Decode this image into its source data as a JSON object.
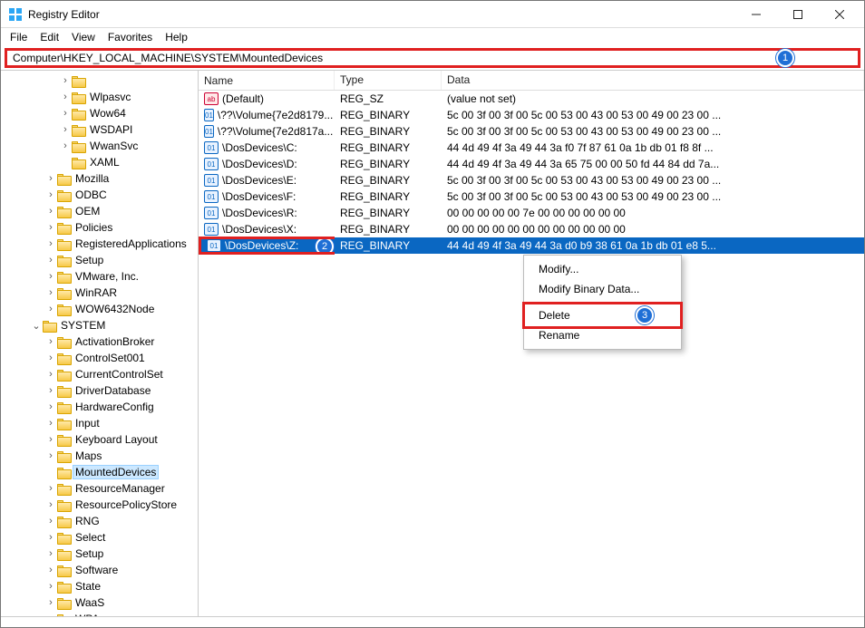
{
  "window": {
    "title": "Registry Editor"
  },
  "menu": {
    "file": "File",
    "edit": "Edit",
    "view": "View",
    "favorites": "Favorites",
    "help": "Help"
  },
  "address": {
    "path": "Computer\\HKEY_LOCAL_MACHINE\\SYSTEM\\MountedDevices"
  },
  "callouts": {
    "one": "1",
    "two": "2",
    "three": "3"
  },
  "tree": {
    "items": [
      {
        "depth": 4,
        "exp": "closed",
        "label": ""
      },
      {
        "depth": 4,
        "exp": "closed",
        "label": "Wlpasvc"
      },
      {
        "depth": 4,
        "exp": "closed",
        "label": "Wow64"
      },
      {
        "depth": 4,
        "exp": "closed",
        "label": "WSDAPI"
      },
      {
        "depth": 4,
        "exp": "closed",
        "label": "WwanSvc"
      },
      {
        "depth": 4,
        "exp": "none",
        "label": "XAML"
      },
      {
        "depth": 3,
        "exp": "closed",
        "label": "Mozilla"
      },
      {
        "depth": 3,
        "exp": "closed",
        "label": "ODBC"
      },
      {
        "depth": 3,
        "exp": "closed",
        "label": "OEM"
      },
      {
        "depth": 3,
        "exp": "closed",
        "label": "Policies"
      },
      {
        "depth": 3,
        "exp": "closed",
        "label": "RegisteredApplications"
      },
      {
        "depth": 3,
        "exp": "closed",
        "label": "Setup"
      },
      {
        "depth": 3,
        "exp": "closed",
        "label": "VMware, Inc."
      },
      {
        "depth": 3,
        "exp": "closed",
        "label": "WinRAR"
      },
      {
        "depth": 3,
        "exp": "closed",
        "label": "WOW6432Node"
      },
      {
        "depth": 2,
        "exp": "open",
        "label": "SYSTEM"
      },
      {
        "depth": 3,
        "exp": "closed",
        "label": "ActivationBroker"
      },
      {
        "depth": 3,
        "exp": "closed",
        "label": "ControlSet001"
      },
      {
        "depth": 3,
        "exp": "closed",
        "label": "CurrentControlSet"
      },
      {
        "depth": 3,
        "exp": "closed",
        "label": "DriverDatabase"
      },
      {
        "depth": 3,
        "exp": "closed",
        "label": "HardwareConfig"
      },
      {
        "depth": 3,
        "exp": "closed",
        "label": "Input"
      },
      {
        "depth": 3,
        "exp": "closed",
        "label": "Keyboard Layout"
      },
      {
        "depth": 3,
        "exp": "closed",
        "label": "Maps"
      },
      {
        "depth": 3,
        "exp": "none",
        "label": "MountedDevices",
        "selected": true
      },
      {
        "depth": 3,
        "exp": "closed",
        "label": "ResourceManager"
      },
      {
        "depth": 3,
        "exp": "closed",
        "label": "ResourcePolicyStore"
      },
      {
        "depth": 3,
        "exp": "closed",
        "label": "RNG"
      },
      {
        "depth": 3,
        "exp": "closed",
        "label": "Select"
      },
      {
        "depth": 3,
        "exp": "closed",
        "label": "Setup"
      },
      {
        "depth": 3,
        "exp": "closed",
        "label": "Software"
      },
      {
        "depth": 3,
        "exp": "closed",
        "label": "State"
      },
      {
        "depth": 3,
        "exp": "closed",
        "label": "WaaS"
      },
      {
        "depth": 3,
        "exp": "closed",
        "label": "WPA"
      }
    ]
  },
  "columns": {
    "name": "Name",
    "type": "Type",
    "data": "Data"
  },
  "values": [
    {
      "name": "(Default)",
      "kind": "str",
      "type": "REG_SZ",
      "data": "(value not set)"
    },
    {
      "name": "\\??\\Volume{7e2d8179...",
      "kind": "bin",
      "type": "REG_BINARY",
      "data": "5c 00 3f 00 3f 00 5c 00 53 00 43 00 53 00 49 00 23 00 ..."
    },
    {
      "name": "\\??\\Volume{7e2d817a...",
      "kind": "bin",
      "type": "REG_BINARY",
      "data": "5c 00 3f 00 3f 00 5c 00 53 00 43 00 53 00 49 00 23 00 ..."
    },
    {
      "name": "\\DosDevices\\C:",
      "kind": "bin",
      "type": "REG_BINARY",
      "data": "44 4d 49 4f 3a 49 44 3a f0 7f 87 61 0a 1b db 01 f8 8f ..."
    },
    {
      "name": "\\DosDevices\\D:",
      "kind": "bin",
      "type": "REG_BINARY",
      "data": "44 4d 49 4f 3a 49 44 3a 65 75 00 00 50 fd 44 84 dd 7a..."
    },
    {
      "name": "\\DosDevices\\E:",
      "kind": "bin",
      "type": "REG_BINARY",
      "data": "5c 00 3f 00 3f 00 5c 00 53 00 43 00 53 00 49 00 23 00 ..."
    },
    {
      "name": "\\DosDevices\\F:",
      "kind": "bin",
      "type": "REG_BINARY",
      "data": "5c 00 3f 00 3f 00 5c 00 53 00 43 00 53 00 49 00 23 00 ..."
    },
    {
      "name": "\\DosDevices\\R:",
      "kind": "bin",
      "type": "REG_BINARY",
      "data": "00 00 00 00 00 7e 00 00 00 00 00 00"
    },
    {
      "name": "\\DosDevices\\X:",
      "kind": "bin",
      "type": "REG_BINARY",
      "data": "00 00 00 00 00 00 00 00 00 00 00 00"
    },
    {
      "name": "\\DosDevices\\Z:",
      "kind": "bin",
      "type": "REG_BINARY",
      "data": "44 4d 49 4f 3a 49 44 3a d0 b9 38 61 0a 1b db 01 e8 5...",
      "selected": true,
      "redbox": true
    }
  ],
  "context_menu": {
    "modify": "Modify...",
    "modify_bin": "Modify Binary Data...",
    "delete": "Delete",
    "rename": "Rename"
  }
}
